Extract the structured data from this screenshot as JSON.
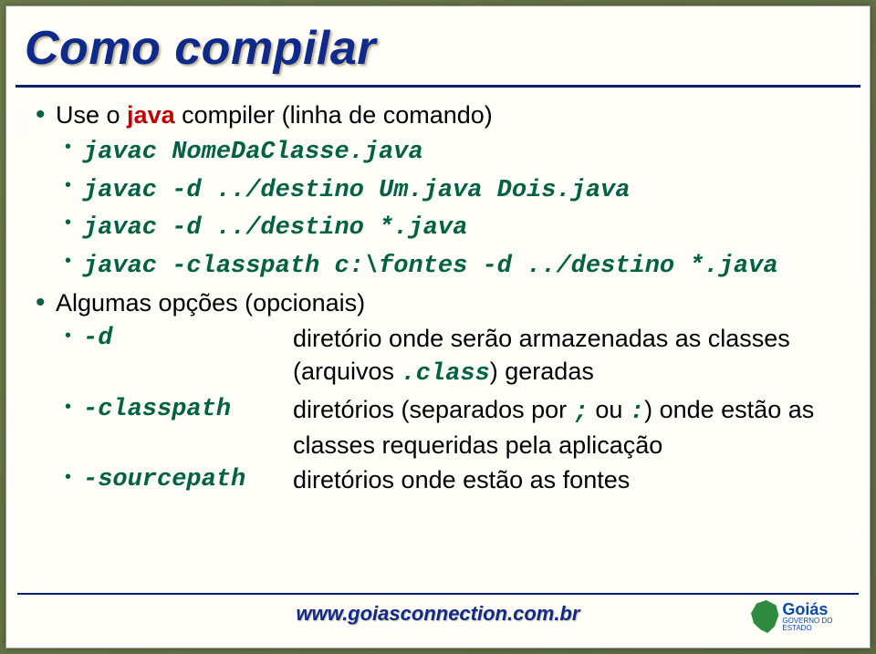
{
  "title": "Como compilar",
  "bullets": {
    "line1_pre": "Use o ",
    "line1_java": "java",
    "line1_post": " compiler (linha de comando)",
    "cmd1": "javac NomeDaClasse.java",
    "cmd2": "javac -d ../destino Um.java Dois.java",
    "cmd3": "javac -d ../destino *.java",
    "cmd4": "javac -classpath c:\\fontes -d ../destino *.java",
    "opts_label": "Algumas opções (opcionais)",
    "opt_d_term": "-d",
    "opt_d_desc_pre": "diretório onde serão armazenadas as classes (arquivos ",
    "opt_d_desc_mono": ".class",
    "opt_d_desc_post": ") geradas",
    "opt_cp_term": "-classpath",
    "opt_cp_desc_pre": "diretórios (separados por ",
    "opt_cp_desc_m1": ";",
    "opt_cp_desc_mid": " ou ",
    "opt_cp_desc_m2": ":",
    "opt_cp_desc_post": ") onde estão as classes requeridas pela aplicação",
    "opt_sp_term": "-sourcepath",
    "opt_sp_desc": "diretórios onde estão as fontes"
  },
  "footer": {
    "url": "www.goiasconnection.com.br",
    "logo_name": "Goiás",
    "logo_sub": "GOVERNO DO ESTADO"
  }
}
